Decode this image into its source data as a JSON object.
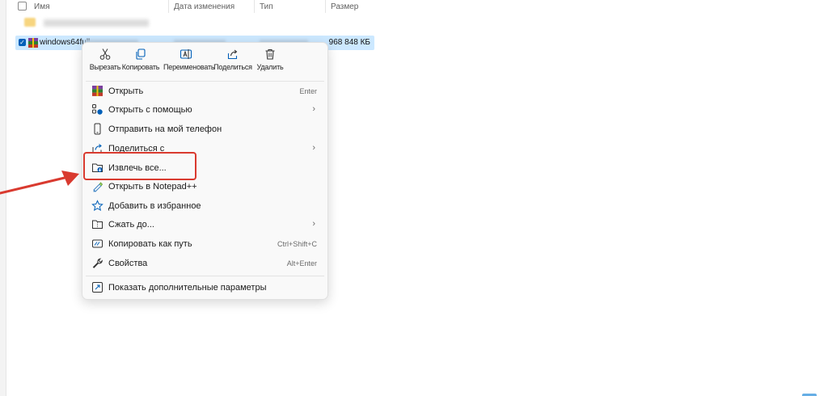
{
  "file_list": {
    "columns": [
      "Имя",
      "Дата изменения",
      "Тип",
      "Размер"
    ],
    "selected_file": {
      "name_visible": "windows64full",
      "size": "968 848 КБ"
    }
  },
  "quick_actions": [
    {
      "label": "Вырезать",
      "icon": "scissors-icon"
    },
    {
      "label": "Копировать",
      "icon": "copy-icon"
    },
    {
      "label": "Переименовать",
      "icon": "rename-icon"
    },
    {
      "label": "Поделиться",
      "icon": "share-icon"
    },
    {
      "label": "Удалить",
      "icon": "trash-icon"
    }
  ],
  "menu_items": [
    {
      "label": "Открыть",
      "shortcut": "Enter",
      "icon": "winrar-icon"
    },
    {
      "label": "Открыть с помощью",
      "icon": "open-with-icon",
      "submenu": true
    },
    {
      "label": "Отправить на мой телефон",
      "icon": "phone-icon"
    },
    {
      "label": "Поделиться с",
      "icon": "share-with-icon",
      "submenu": true
    },
    {
      "label": "Извлечь все...",
      "icon": "extract-folder-icon",
      "highlighted": true
    },
    {
      "label": "Открыть в Notepad++",
      "icon": "notepad-icon"
    },
    {
      "label": "Добавить в избранное",
      "icon": "star-icon"
    },
    {
      "label": "Сжать до...",
      "icon": "compress-icon",
      "submenu": true
    },
    {
      "label": "Копировать как путь",
      "shortcut": "Ctrl+Shift+C",
      "icon": "copy-path-icon"
    },
    {
      "label": "Свойства",
      "shortcut": "Alt+Enter",
      "icon": "wrench-icon"
    }
  ],
  "footer_item": {
    "label": "Показать дополнительные параметры",
    "icon": "more-options-icon"
  },
  "colors": {
    "accent": "#005fb8",
    "selection": "#cce8ff",
    "annotation_red": "#d93a2f"
  }
}
